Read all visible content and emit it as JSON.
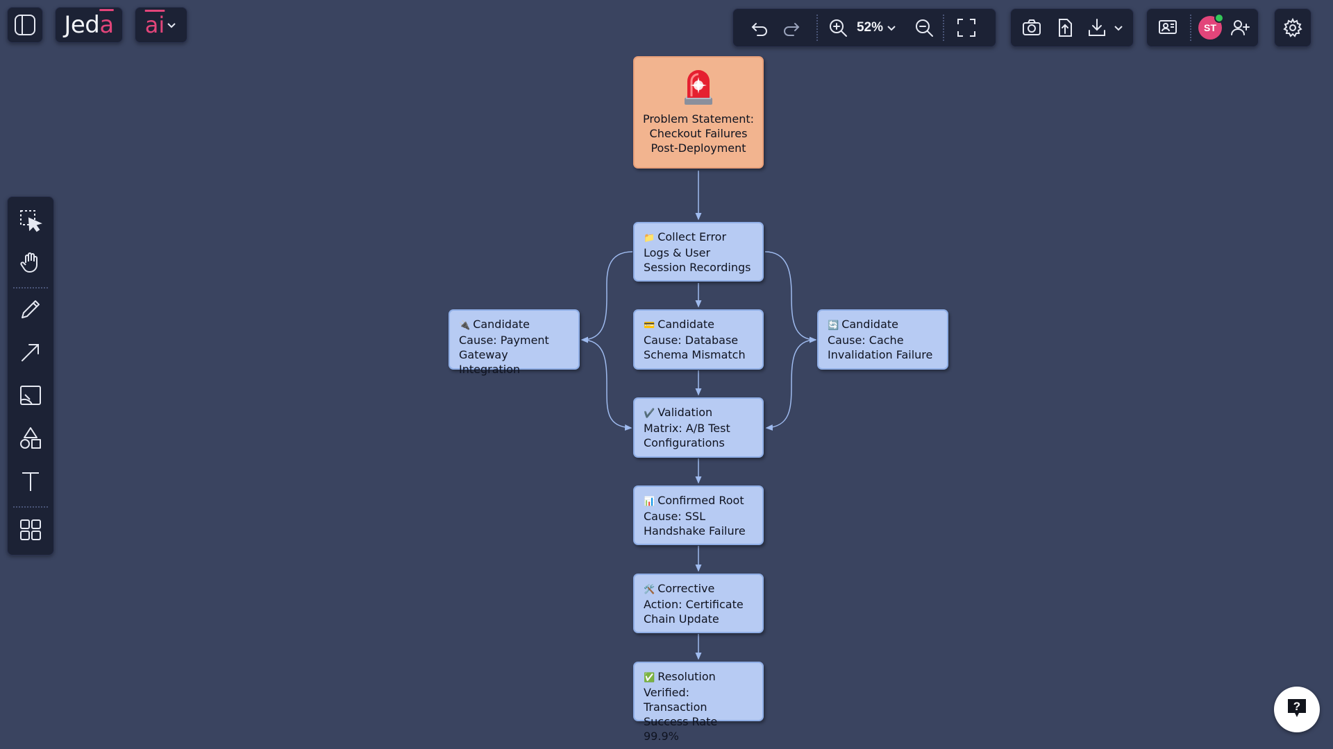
{
  "app": {
    "logo_prefix": "Jed",
    "logo_accent": "a",
    "ai_label": "ai"
  },
  "toolbar": {
    "zoom_label": "52%",
    "user_initials": "ST"
  },
  "colors": {
    "canvas_bg": "#3a4460",
    "panel_bg": "#1c2235",
    "node_fill": "#b7cbf3",
    "problem_fill": "#f2b48f",
    "accent_pink": "#e2457a",
    "online_green": "#34c759"
  },
  "left_tools": [
    {
      "name": "select-tool",
      "icon": "select-icon"
    },
    {
      "name": "hand-tool",
      "icon": "hand-icon"
    },
    {
      "name": "pencil-tool",
      "icon": "pencil-icon"
    },
    {
      "name": "arrow-tool",
      "icon": "arrow-icon"
    },
    {
      "name": "image-tool",
      "icon": "image-icon"
    },
    {
      "name": "shapes-tool",
      "icon": "shapes-icon"
    },
    {
      "name": "text-tool",
      "icon": "text-icon"
    },
    {
      "name": "grid-tool",
      "icon": "grid-icon"
    }
  ],
  "diagram": {
    "problem": {
      "icon": "siren-icon",
      "text": "Problem Statement: Checkout Failures Post-Deployment"
    },
    "nodes": {
      "collect": {
        "emoji": "📁",
        "text": "Collect Error Logs & User Session Recordings"
      },
      "payment": {
        "emoji": "🔌",
        "text": "Candidate Cause: Payment Gateway Integration"
      },
      "database": {
        "emoji": "💳",
        "text": "Candidate Cause: Database Schema Mismatch"
      },
      "cache": {
        "emoji": "🔄",
        "text": "Candidate Cause: Cache Invalidation Failure"
      },
      "validation": {
        "emoji": "✔️",
        "text": "Validation Matrix: A/B Test Configurations"
      },
      "rootcause": {
        "emoji": "📊",
        "text": "Confirmed Root Cause: SSL Handshake Failure"
      },
      "corrective": {
        "emoji": "🛠️",
        "text": "Corrective Action: Certificate Chain Update"
      },
      "resolution": {
        "emoji": "✅",
        "text": "Resolution Verified: Transaction Success Rate 99.9%"
      }
    }
  }
}
